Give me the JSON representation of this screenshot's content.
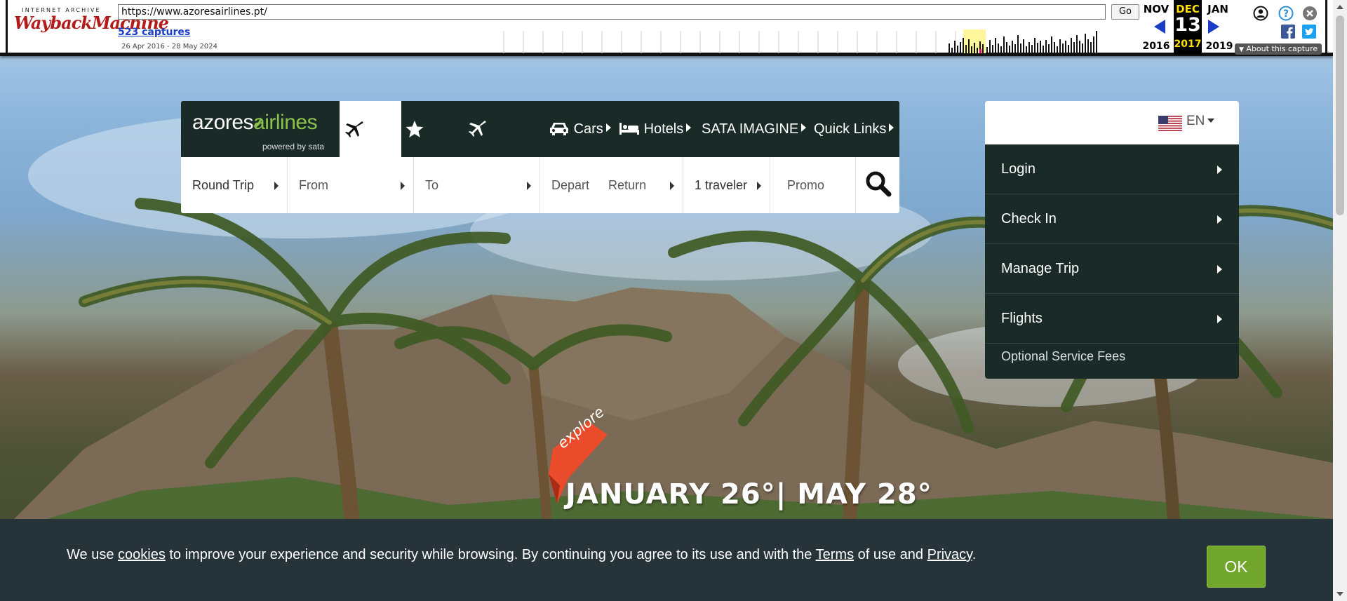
{
  "wayback": {
    "logo_top": "INTERNET ARCHIVE",
    "logo_main": "WaybackMachine",
    "url": "https://www.azoresairlines.pt/",
    "go_label": "Go",
    "captures": "523 captures",
    "range": "26 Apr 2016 - 28 May 2024",
    "prev_month": "NOV",
    "prev_year": "2016",
    "cur_month": "DEC",
    "cur_day": "13",
    "cur_year": "2017",
    "next_month": "JAN",
    "next_year": "2019",
    "about": "About this capture",
    "icons": [
      "user-icon",
      "help-icon",
      "close-icon",
      "facebook-icon",
      "twitter-icon"
    ]
  },
  "booking": {
    "logo_brand_1": "azores",
    "logo_brand_2": "airlines",
    "logo_powered": "powered by sata",
    "nav": {
      "cars": "Cars",
      "hotels": "Hotels",
      "imagine": "SATA IMAGINE",
      "quick": "Quick Links"
    },
    "fields": {
      "trip": "Round Trip",
      "from": "From",
      "to": "To",
      "depart": "Depart",
      "return": "Return",
      "travelers": "1 traveler",
      "promo": "Promo"
    }
  },
  "side_menu": {
    "lang": "EN",
    "items": [
      "Login",
      "Check In",
      "Manage Trip",
      "Flights"
    ],
    "small": "Optional Service Fees"
  },
  "hero": {
    "ribbon": "explore",
    "dates": "JANUARY 26°| MAY 28°"
  },
  "cookie": {
    "pre": "We use ",
    "cookies": "cookies",
    "mid": " to improve your experience and security while browsing. By continuing you agree to its use and with the ",
    "terms": "Terms",
    "mid2": " of use and ",
    "privacy": "Privacy",
    "post": ".",
    "ok": "OK"
  },
  "colors": {
    "brand_dark": "#1a2b27",
    "brand_green": "#8bc34a",
    "cookie_bg": "#263338",
    "ok_green": "#6fa62b",
    "wayback_link": "#1a3cc6",
    "wayback_highlight": "#ffe000"
  }
}
